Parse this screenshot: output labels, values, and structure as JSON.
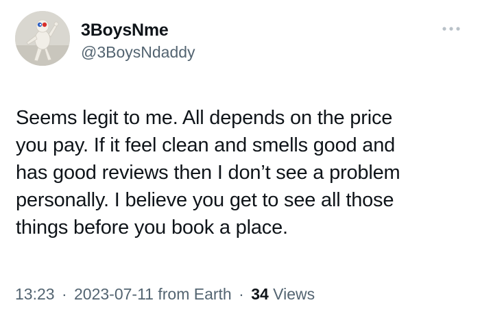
{
  "author": {
    "display_name": "3BoysNme",
    "handle": "@3BoysNdaddy",
    "avatar_icon": "figure-avatar-icon"
  },
  "tweet": {
    "text": "Seems legit to me. All depends on the price\nyou pay. If it feel clean and smells good and\nhas good reviews then I don’t see a problem\npersonally. I believe you get to see all those\nthings before you book a place."
  },
  "meta": {
    "time": "13:23",
    "separator": "·",
    "date": "2023-07-11",
    "source": "from Earth",
    "views_count": "34",
    "views_label": "Views"
  },
  "icons": {
    "more": "more-options-icon"
  },
  "colors": {
    "text": "#0f1419",
    "secondary": "#536471",
    "background": "#ffffff"
  }
}
